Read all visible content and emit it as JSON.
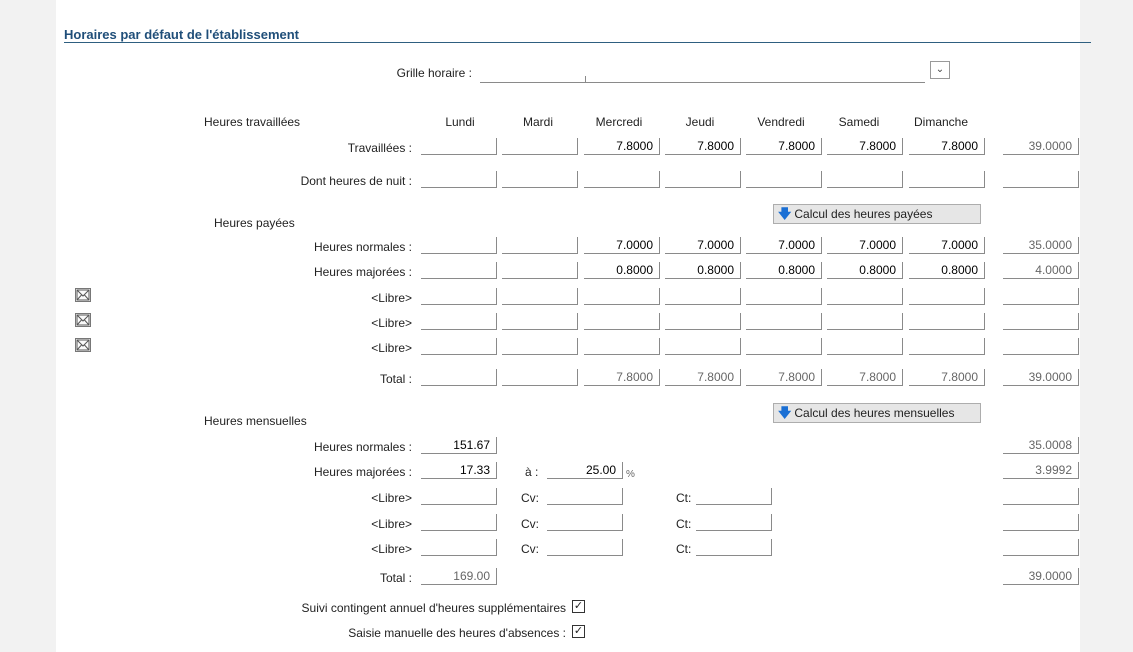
{
  "section": {
    "title": "Horaires par défaut de l'établissement"
  },
  "grille": {
    "label": "Grille horaire :",
    "value": ""
  },
  "worked": {
    "heading": "Heures travaillées",
    "days": [
      "Lundi",
      "Mardi",
      "Mercredi",
      "Jeudi",
      "Vendredi",
      "Samedi",
      "Dimanche"
    ],
    "rows": [
      {
        "label": "Travaillées :",
        "values": [
          "",
          "",
          "7.8000",
          "7.8000",
          "7.8000",
          "7.8000",
          "7.8000"
        ],
        "total": "39.0000"
      },
      {
        "label": "Dont heures de nuit :",
        "values": [
          "",
          "",
          "",
          "",
          "",
          "",
          ""
        ],
        "total": ""
      }
    ]
  },
  "paid": {
    "heading": "Heures payées",
    "button": "Calcul des heures payées",
    "rows": [
      {
        "label": "Heures normales :",
        "values": [
          "",
          "",
          "7.0000",
          "7.0000",
          "7.0000",
          "7.0000",
          "7.0000"
        ],
        "total": "35.0000"
      },
      {
        "label": "Heures majorées :",
        "values": [
          "",
          "",
          "0.8000",
          "0.8000",
          "0.8000",
          "0.8000",
          "0.8000"
        ],
        "total": "4.0000"
      },
      {
        "label": "<Libre>",
        "values": [
          "",
          "",
          "",
          "",
          "",
          "",
          ""
        ],
        "total": ""
      },
      {
        "label": "<Libre>",
        "values": [
          "",
          "",
          "",
          "",
          "",
          "",
          ""
        ],
        "total": ""
      },
      {
        "label": "<Libre>",
        "values": [
          "",
          "",
          "",
          "",
          "",
          "",
          ""
        ],
        "total": ""
      },
      {
        "label": "Total :",
        "values": [
          "",
          "",
          "7.8000",
          "7.8000",
          "7.8000",
          "7.8000",
          "7.8000"
        ],
        "total": "39.0000"
      }
    ]
  },
  "monthly": {
    "heading": "Heures mensuelles",
    "button": "Calcul des heures mensuelles",
    "normales": {
      "label": "Heures normales :",
      "value": "151.67",
      "total": "35.0008"
    },
    "majorees": {
      "label": "Heures majorées :",
      "value": "17.33",
      "a_label": "à :",
      "rate": "25.00",
      "pct": "%",
      "total": "3.9992"
    },
    "libres": [
      {
        "label": "<Libre>",
        "value": "",
        "cv_label": "Cv:",
        "cv": "",
        "ct_label": "Ct:",
        "ct": "",
        "total": ""
      },
      {
        "label": "<Libre>",
        "value": "",
        "cv_label": "Cv:",
        "cv": "",
        "ct_label": "Ct:",
        "ct": "",
        "total": ""
      },
      {
        "label": "<Libre>",
        "value": "",
        "cv_label": "Cv:",
        "cv": "",
        "ct_label": "Ct:",
        "ct": "",
        "total": ""
      }
    ],
    "total": {
      "label": "Total :",
      "value": "169.00",
      "total": "39.0000"
    }
  },
  "options": {
    "contingent": {
      "label": "Suivi contingent annuel d'heures supplémentaires",
      "checked": true
    },
    "absences": {
      "label": "Saisie manuelle des heures d'absences :",
      "checked": true
    }
  },
  "icons": {
    "mail": "envelope-icon",
    "arrow": "arrow-down-icon",
    "dropdown": "chevron-down-icon"
  }
}
